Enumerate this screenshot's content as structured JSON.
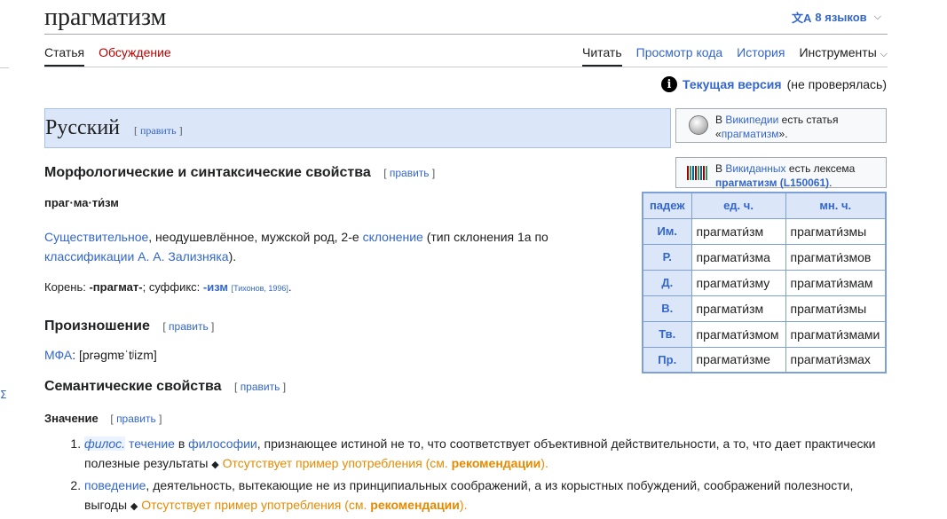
{
  "title": "прагматизм",
  "languages_button": "8 языков",
  "tabs_left": [
    "Статья",
    "Обсуждение"
  ],
  "tabs_right": [
    "Читать",
    "Просмотр кода",
    "История",
    "Инструменты"
  ],
  "version": {
    "link": "Текущая версия",
    "note": "(не проверялась)"
  },
  "edit_label": "править",
  "language_header": "Русский",
  "wikipedia_box": {
    "prefix": "В ",
    "link1": "Википедии",
    "middle": " есть статья «",
    "link2": "прагматизм",
    "suffix": "»."
  },
  "wikidata_box": {
    "prefix": "В ",
    "link1": "Викиданных",
    "middle": " есть лексема ",
    "link2": "прагматизм (L150061)",
    "suffix": "."
  },
  "morph_heading": "Морфологические и синтаксические свойства",
  "syllables": "праг·ма·ти́зм",
  "pos": {
    "link1": "Существительное",
    "text1": ", неодушевлённое, мужской род, 2-е ",
    "link2": "склонение",
    "text2": " (тип склонения 1a по ",
    "link3": "классификации А. А. Зализняка",
    "text3": ")."
  },
  "root_line": {
    "label1": "Корень: ",
    "root": "-прагмат-",
    "label2": "; суффикс: ",
    "suffix": "-изм",
    "source": "[Тихонов, 1996]",
    "end": "."
  },
  "pron_heading": "Произношение",
  "ipa": {
    "link": "МФА",
    "text": ": [prəɡmɐˈtʲizm]"
  },
  "sem_heading": "Семантические свойства",
  "meaning_heading": "Значение",
  "declension": {
    "headers": [
      "падеж",
      "ед. ч.",
      "мн. ч."
    ],
    "rows": [
      {
        "case": "Им.",
        "sg": "прагмати́зм",
        "pl": "прагмати́змы"
      },
      {
        "case": "Р.",
        "sg": "прагмати́зма",
        "pl": "прагмати́змов"
      },
      {
        "case": "Д.",
        "sg": "прагмати́зму",
        "pl": "прагмати́змам"
      },
      {
        "case": "В.",
        "sg": "прагмати́зм",
        "pl": "прагмати́змы"
      },
      {
        "case": "Тв.",
        "sg": "прагмати́змом",
        "pl": "прагмати́змами"
      },
      {
        "case": "Пр.",
        "sg": "прагмати́зме",
        "pl": "прагмати́змах"
      }
    ]
  },
  "meanings": [
    {
      "label": "филос.",
      "link": "течение",
      "text1": " в ",
      "link2": "философии",
      "text2": ", признающее истиной не то, что соответствует объективной действительности, а то, что дает практически полезные результаты ",
      "missing": "Отсутствует пример употребления (см. ",
      "missing_link": "рекомендации",
      "missing_end": ")."
    },
    {
      "label": "",
      "link": "поведение",
      "text1": ", деятельность, вытекающие не из принципиальных соображений, а из корыстных побуждений, соображений полезности, выгоды ",
      "link2": "",
      "text2": "",
      "missing": "Отсутствует пример употребления (см. ",
      "missing_link": "рекомендации",
      "missing_end": ")."
    }
  ],
  "colors": {
    "link": "#3366cc",
    "header_bg": "#dbe7f8",
    "missing": "#e68a00"
  }
}
